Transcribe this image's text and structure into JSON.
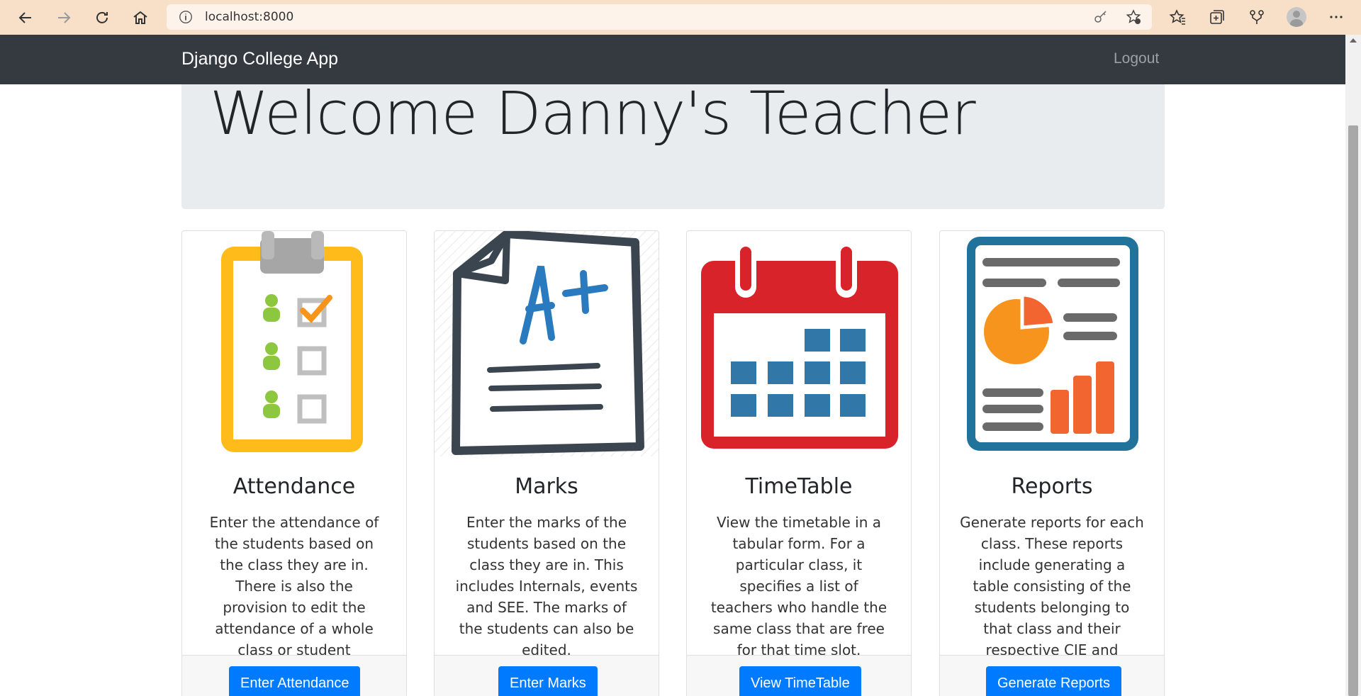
{
  "browser": {
    "url": "localhost:8000"
  },
  "navbar": {
    "brand": "Django College App",
    "logout": "Logout"
  },
  "jumbotron": {
    "title": "Welcome Danny's Teacher"
  },
  "cards": [
    {
      "title": "Attendance",
      "text": "Enter the attendance of the students based on the class they are in. There is also the provision to edit the attendance of a whole class or student individually.",
      "button": "Enter Attendance",
      "icon": "clipboard-checklist-icon"
    },
    {
      "title": "Marks",
      "text": "Enter the marks of the students based on the class they are in. This includes Internals, events and SEE. The marks of the students can also be edited.",
      "button": "Enter Marks",
      "icon": "grade-paper-icon"
    },
    {
      "title": "TimeTable",
      "text": "View the timetable in a tabular form. For a particular class, it specifies a list of teachers who handle the same class that are free for that time slot.",
      "button": "View TimeTable",
      "icon": "calendar-icon"
    },
    {
      "title": "Reports",
      "text": "Generate reports for each class. These reports include generating a table consisting of the students belonging to that class and their respective CIE and Attendance.",
      "button": "Generate Reports",
      "icon": "report-chart-icon"
    }
  ],
  "colors": {
    "primary": "#007bff",
    "navbar": "#343a40",
    "jumbotron": "#e9ecef",
    "browser_bar": "#f8e0c8"
  }
}
